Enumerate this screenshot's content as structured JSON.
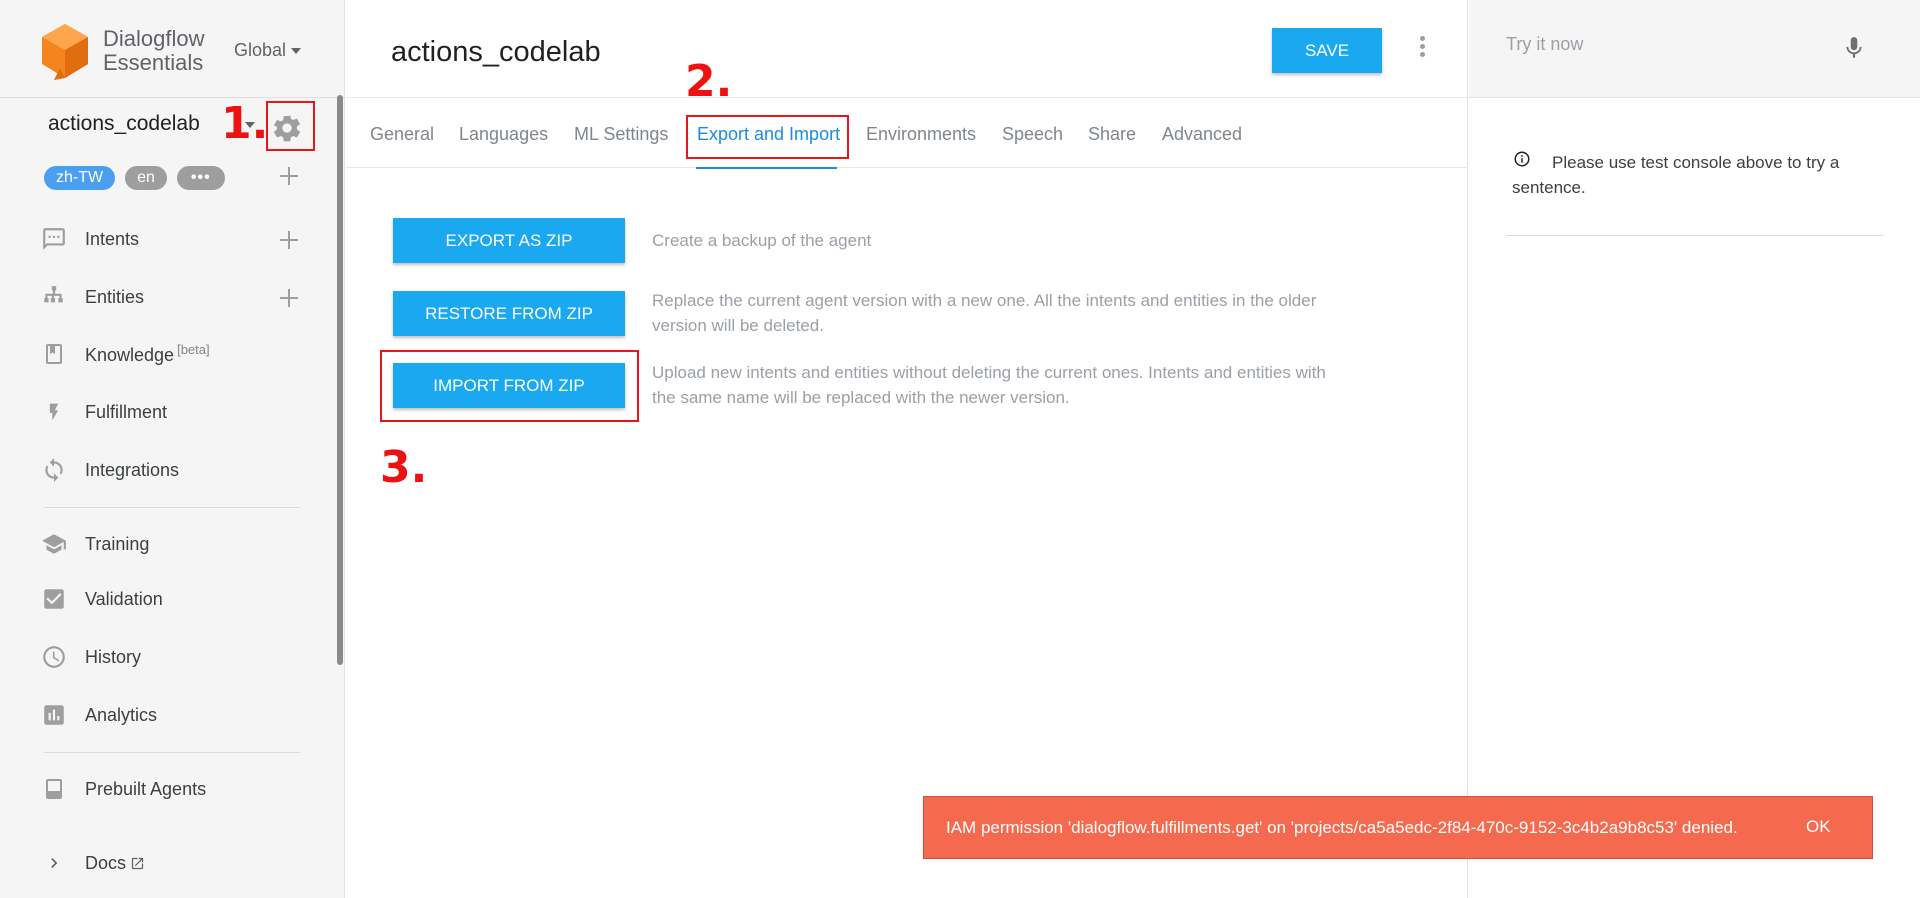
{
  "brand": {
    "name_line1": "Dialogflow",
    "name_line2": "Essentials",
    "region": "Global"
  },
  "agent": {
    "name": "actions_codelab"
  },
  "languages": [
    "zh-TW",
    "en"
  ],
  "languages_more": "•••",
  "nav": {
    "intents": "Intents",
    "entities": "Entities",
    "knowledge": "Knowledge",
    "knowledge_badge": "[beta]",
    "fulfillment": "Fulfillment",
    "integrations": "Integrations",
    "training": "Training",
    "validation": "Validation",
    "history": "History",
    "analytics": "Analytics",
    "prebuilt_agents": "Prebuilt Agents",
    "docs": "Docs"
  },
  "header": {
    "title": "actions_codelab",
    "save_label": "SAVE"
  },
  "tabs": [
    {
      "label": "General"
    },
    {
      "label": "Languages"
    },
    {
      "label": "ML Settings"
    },
    {
      "label": "Export and Import",
      "active": true
    },
    {
      "label": "Environments"
    },
    {
      "label": "Speech"
    },
    {
      "label": "Share"
    },
    {
      "label": "Advanced"
    }
  ],
  "actions": {
    "export": {
      "label": "EXPORT AS ZIP",
      "desc": "Create a backup of the agent"
    },
    "restore": {
      "label": "RESTORE FROM ZIP",
      "desc": "Replace the current agent version with a new one. All the intents and entities in the older version will be deleted."
    },
    "import": {
      "label": "IMPORT FROM ZIP",
      "desc": "Upload new intents and entities without deleting the current ones. Intents and entities with the same name will be replaced with the newer version."
    }
  },
  "annotations": {
    "step1": "1.",
    "step2": "2.",
    "step3": "3."
  },
  "test_console": {
    "placeholder": "Try it now",
    "info": "Please use test console above to try a sentence."
  },
  "toast": {
    "message": "IAM permission 'dialogflow.fulfillments.get' on 'projects/ca5a5edc-2f84-470c-9152-3c4b2a9b8c53' denied.",
    "ok_label": "OK"
  },
  "colors": {
    "accent": "#1aa9f0",
    "tab_active": "#1a8cde",
    "annotation_red": "#e8161b",
    "toast_bg": "#f56a4f",
    "logo_orange": "#f5841f"
  }
}
